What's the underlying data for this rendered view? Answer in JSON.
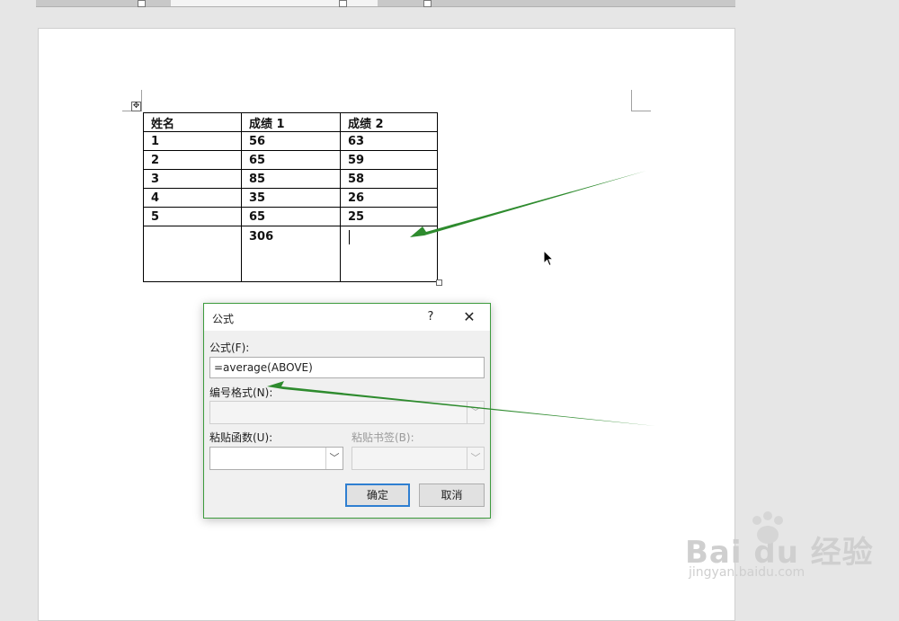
{
  "table": {
    "header": [
      "姓名",
      "成绩 1",
      "成绩 2"
    ],
    "rows": [
      [
        "1",
        "56",
        "63"
      ],
      [
        "2",
        "65",
        "59"
      ],
      [
        "3",
        "85",
        "58"
      ],
      [
        "4",
        "35",
        "26"
      ],
      [
        "5",
        "65",
        "25"
      ]
    ],
    "total_row": [
      "",
      "306",
      ""
    ]
  },
  "dialog": {
    "title": "公式",
    "help_label": "?",
    "close_label": "✕",
    "formula_label": "公式(F):",
    "formula_value": "=average(ABOVE)",
    "number_format_label": "编号格式(N):",
    "number_format_value": "",
    "paste_function_label": "粘贴函数(U):",
    "paste_bookmark_label": "粘贴书签(B):",
    "ok_label": "确定",
    "cancel_label": "取消"
  },
  "icons": {
    "table_handle": "move-icon",
    "dropdown": "chevron-down-icon",
    "mouse": "arrow-cursor-icon"
  },
  "annotation_color": "#2e8b2e",
  "watermark": {
    "brand": "Bai du 经验",
    "url": "jingyan.baidu.com"
  }
}
